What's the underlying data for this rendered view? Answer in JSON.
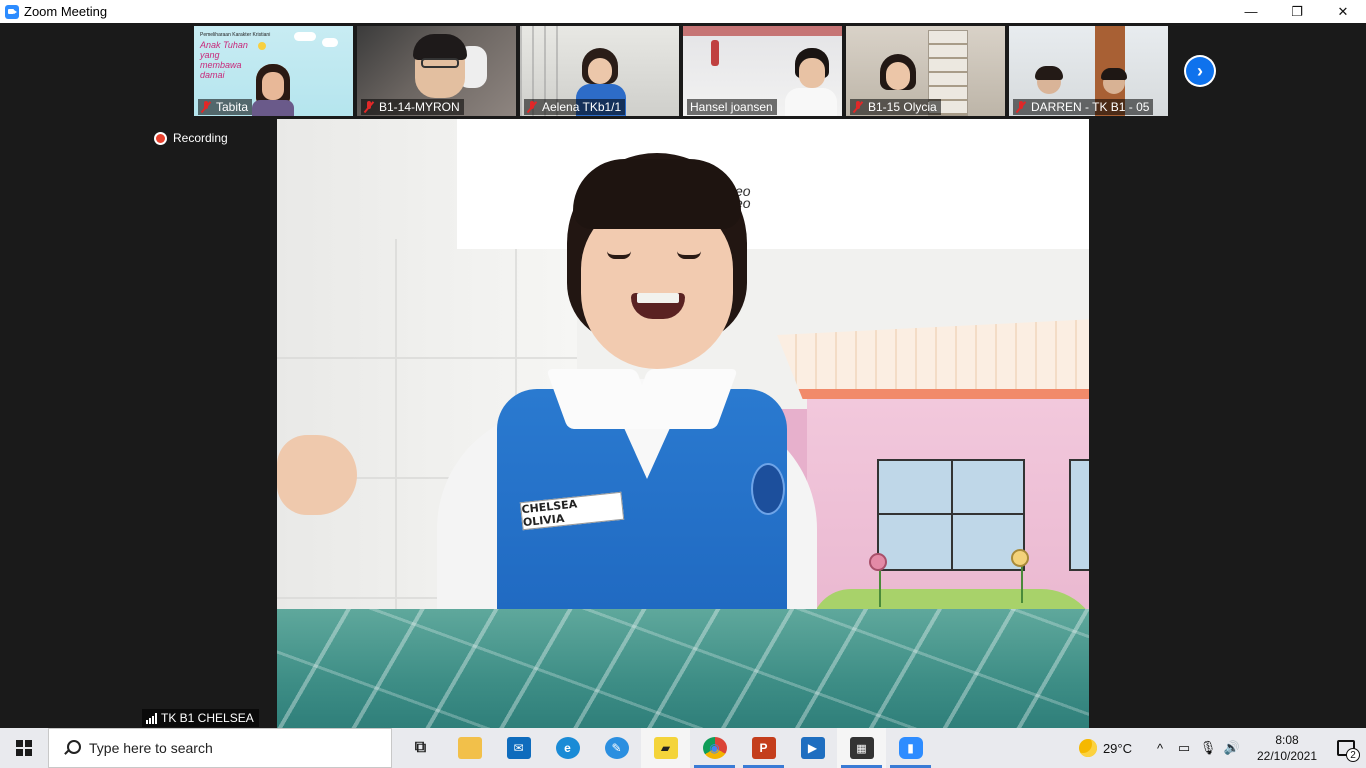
{
  "window": {
    "title": "Zoom Meeting",
    "controls": {
      "minimize": "—",
      "restore": "❐",
      "close": "✕"
    }
  },
  "thumbnails": [
    {
      "name": "Tabita",
      "muted": true,
      "slide_title": "Pemeliharaan Karakter Kristiani",
      "slide_main": "Anak Tuhan yang membawa damai"
    },
    {
      "name": "B1-14-MYRON",
      "muted": true
    },
    {
      "name": "Aelena TKb1/1",
      "muted": true
    },
    {
      "name": "Hansel joansen",
      "muted": false
    },
    {
      "name": "B1-15 Olycia",
      "muted": true
    },
    {
      "name": "DARREN - TK B1 - 05",
      "muted": true
    }
  ],
  "next_button": {
    "glyph": "›"
  },
  "recording": {
    "label": "Recording"
  },
  "main_video": {
    "participant_name": "TK B1 CHELSEA",
    "nametag_text": "CHELSEA OLIVIA",
    "wall_writing": "eo eo"
  },
  "taskbar": {
    "search_placeholder": "Type here to search",
    "apps": [
      {
        "name": "task-view",
        "label": "⧉"
      },
      {
        "name": "file-explorer",
        "label": "📁"
      },
      {
        "name": "mail",
        "label": "✉"
      },
      {
        "name": "edge",
        "label": "e"
      },
      {
        "name": "photos",
        "label": "✎"
      },
      {
        "name": "sticky-notes",
        "label": "▰"
      },
      {
        "name": "chrome",
        "label": "◉"
      },
      {
        "name": "powerpoint",
        "label": "P"
      },
      {
        "name": "movie-maker",
        "label": "▶"
      },
      {
        "name": "video-editor",
        "label": "🎬"
      },
      {
        "name": "zoom",
        "label": "▮"
      }
    ],
    "weather": "29°C",
    "tray_chevron": "^",
    "time": "8:08",
    "date": "22/10/2021",
    "notifications": "2"
  },
  "colors": {
    "zoom_blue": "#0e72ed",
    "recording_red": "#e8412e",
    "mute_red": "#e02828"
  }
}
